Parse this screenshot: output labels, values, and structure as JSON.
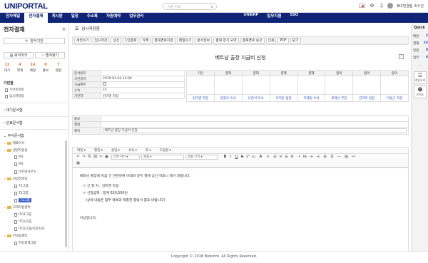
{
  "header": {
    "logo": "UNIPORTAL",
    "search_placeholder": "사원 검색",
    "user": "BIZ연결팀 조수진",
    "icon_names": [
      "korea-flag-icon",
      "settings-icon",
      "bell-icon",
      "avatar"
    ]
  },
  "nav": {
    "left": [
      "전자메일",
      "전자결재",
      "게시판",
      "일정",
      "주소록",
      "자원예약",
      "업무관리"
    ],
    "right": [
      "UNIERP",
      "업무지원",
      "SSO"
    ],
    "active": "전자결재"
  },
  "sidebar": {
    "title": "전자결재",
    "write_button": "양식기안",
    "bookmark_button": "워처마크",
    "favorite_button": "즐겨찾기",
    "stats": [
      {
        "num": "12",
        "label": "대기"
      },
      {
        "num": "4",
        "label": "연계"
      },
      {
        "num": "14",
        "label": "예정"
      },
      {
        "num": "0",
        "label": "통보"
      },
      {
        "num": "7",
        "label": "열람"
      }
    ],
    "draft_section": "기안함",
    "draft_items": [
      "기안문서함",
      "임시저장함"
    ],
    "groups": [
      "대기문서함",
      "완료문서함",
      "부서문서함"
    ],
    "tree": [
      {
        "label": "대표이사",
        "level": 1,
        "type": "folder"
      },
      {
        "label": "경영지원실",
        "level": 1,
        "type": "folder"
      },
      {
        "label": "M1",
        "level": 2,
        "type": "doc"
      },
      {
        "label": "M2",
        "level": 2,
        "type": "doc"
      },
      {
        "label": "비즈넷사무소",
        "level": 2,
        "type": "doc"
      },
      {
        "label": "사업전략실",
        "level": 1,
        "type": "folder"
      },
      {
        "label": "T1그룹",
        "level": 2,
        "type": "doc"
      },
      {
        "label": "T2그룹",
        "level": 2,
        "type": "doc"
      },
      {
        "label": "T3그룹",
        "level": 2,
        "type": "doc",
        "selected": true
      },
      {
        "label": "고객지원센터",
        "level": 1,
        "type": "folder"
      },
      {
        "label": "IT01그룹",
        "level": 2,
        "type": "doc"
      },
      {
        "label": "IT03그룹",
        "level": 2,
        "type": "doc"
      },
      {
        "label": "IT03그룹/보후지사",
        "level": 2,
        "type": "doc"
      },
      {
        "label": "컨설팅센터",
        "level": 1,
        "type": "folder"
      },
      {
        "label": "자유회계그룹",
        "level": 2,
        "type": "doc"
      }
    ]
  },
  "main": {
    "page_title": "임시저장함",
    "toolbar": [
      "세컨쓰기",
      "임시저장",
      "상신",
      "1인결재",
      "삭제",
      "결재경로지정",
      "메일쓰기",
      "문서정보",
      "결재 양식 요약",
      "결재경로 승강",
      "인쇄",
      "PDF",
      "닫기"
    ],
    "doc_title": "베트남 출장 지급비 신청",
    "info": {
      "labels": [
        "문서번호",
        "기안일자",
        "긴급여부",
        "소속",
        "기안자"
      ],
      "values": [
        "",
        "2019-01-04 14:08",
        "",
        "F4",
        "김미영 차장"
      ]
    },
    "approval": {
      "headers": [
        "기안",
        "결재",
        "결재",
        "결재",
        "결재",
        "합의",
        "합의",
        "합의"
      ],
      "names": [
        "김미영 차장",
        "임정호 이사",
        "오준석 이사",
        "이지훈 팀장",
        "조재일 수석",
        "류재선 부장",
        "김미라 팀장",
        "이일근 차장"
      ]
    },
    "fields": {
      "labels": [
        "통보",
        "열람",
        "제목"
      ],
      "subject": "베트남 출장 지급비 신청"
    },
    "editor_menu": [
      "파일",
      "편집",
      "삽입",
      "서식",
      "표",
      "도움말"
    ],
    "editor_selects": [
      "단락 서식",
      "굴림",
      "글꼴 크기"
    ],
    "body_lines": [
      "베트남 출장에 지금 건 관련하여 아래와 같이 결재 상신 하오니 재가 바랍니다.",
      "ㅇ 신 청 자 : 김미영 차장",
      "ㅇ 신청금액 : 합계 630,500원",
      "(상세 내용은 첨부 목록과 제출한 증빙서 참조 바랍니다)",
      "이상입니다."
    ]
  },
  "quick": {
    "title": "Quick",
    "items": [
      {
        "label": "메일",
        "count": "2"
      },
      {
        "label": "결재",
        "count": "24"
      },
      {
        "label": "일정",
        "count": "0"
      },
      {
        "label": "업무",
        "count": "4"
      }
    ],
    "more": "...",
    "boxes": [
      "게임오기",
      "조회도"
    ]
  },
  "footer": "Copyright © 2018 Bizentro. All Rights Reserved."
}
